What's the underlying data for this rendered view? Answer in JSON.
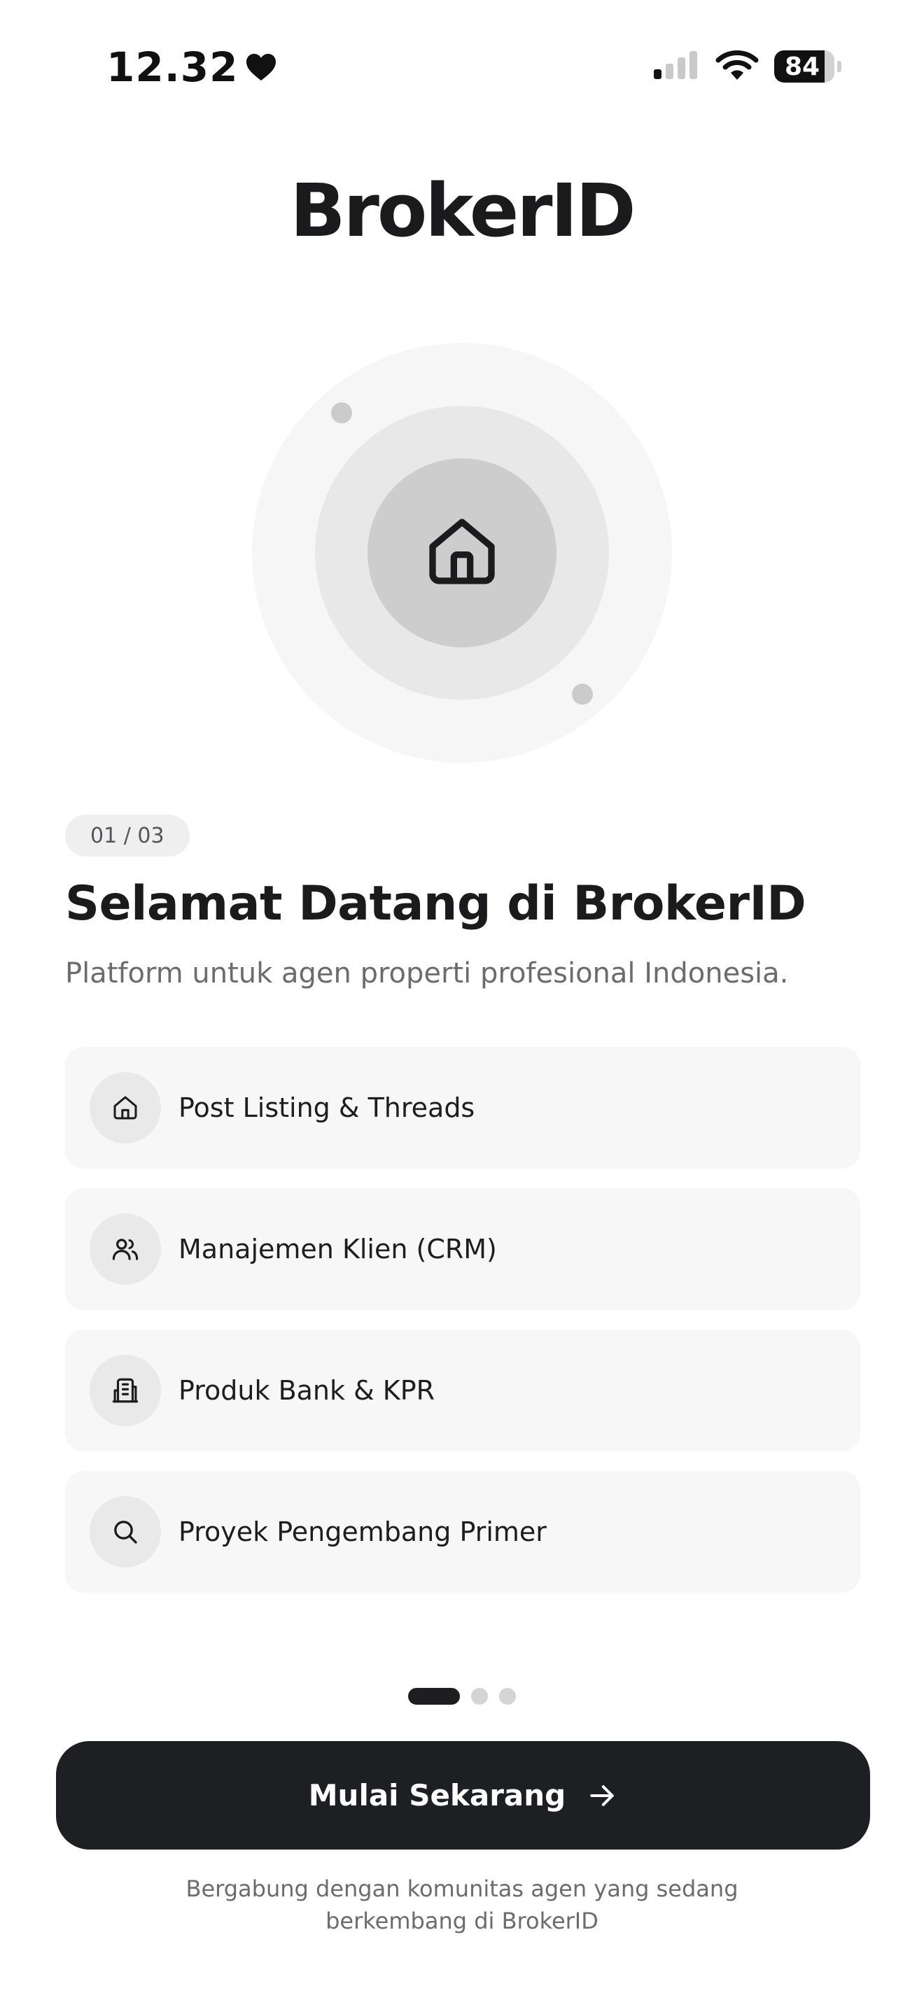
{
  "status_bar": {
    "time": "12.32",
    "battery_level": "84",
    "battery_fraction": 0.84,
    "signal_bars_active": 1,
    "signal_bars_total": 4,
    "icons": [
      "heart-icon",
      "cellular-signal-icon",
      "wifi-icon",
      "battery-icon"
    ]
  },
  "app": {
    "logo_text": "BrokerID"
  },
  "hero": {
    "icon": "home-icon"
  },
  "onboarding": {
    "step_badge": "01 / 03",
    "title": "Selamat Datang di BrokerID",
    "subtitle": "Platform untuk agen properti profesional Indonesia.",
    "current_page": 1,
    "total_pages": 3
  },
  "features": [
    {
      "icon": "home-icon",
      "label": "Post Listing & Threads"
    },
    {
      "icon": "users-icon",
      "label": "Manajemen Klien (CRM)"
    },
    {
      "icon": "building-icon",
      "label": "Produk Bank & KPR"
    },
    {
      "icon": "search-icon",
      "label": "Proyek Pengembang Primer"
    }
  ],
  "cta": {
    "label": "Mulai Sekarang",
    "icon": "arrow-right-icon"
  },
  "footer": {
    "note": "Bergabung dengan komunitas agen yang sedang berkembang di BrokerID"
  },
  "colors": {
    "primary": "#1e1f22",
    "background": "#ffffff",
    "card": "#f7f7f7",
    "muted_text": "#6b6b70"
  }
}
